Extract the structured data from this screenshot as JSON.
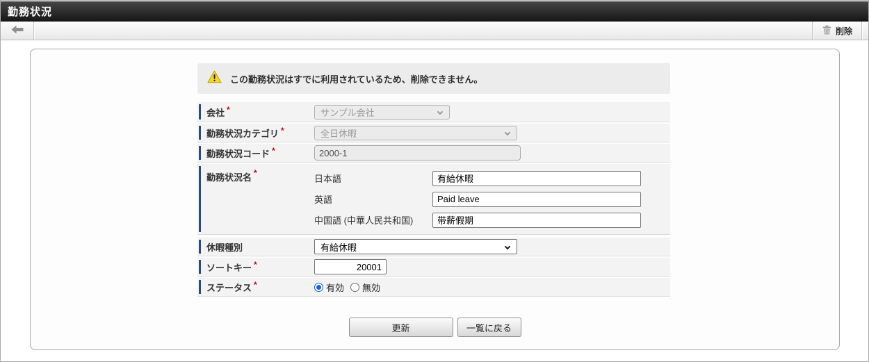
{
  "header": {
    "title": "勤務状況"
  },
  "toolbar": {
    "delete_label": "削除"
  },
  "warning": {
    "message": "この勤務状況はすでに利用されているため、削除できません。"
  },
  "marks": {
    "required": "*"
  },
  "fields": {
    "company": {
      "label": "会社",
      "value": "サンプル会社",
      "disabled": true
    },
    "category": {
      "label": "勤務状況カテゴリ",
      "value": "全日休暇",
      "disabled": true
    },
    "code": {
      "label": "勤務状況コード",
      "value": "2000-1",
      "readonly": true
    },
    "name": {
      "label": "勤務状況名",
      "entries": [
        {
          "lang": "日本語",
          "value": "有給休暇"
        },
        {
          "lang": "英語",
          "value": "Paid leave"
        },
        {
          "lang": "中国語 (中華人民共和国)",
          "value": "带薪假期"
        }
      ]
    },
    "leave_type": {
      "label": "休暇種別",
      "value": "有給休暇"
    },
    "sort_key": {
      "label": "ソートキー",
      "value": "20001"
    },
    "status": {
      "label": "ステータス",
      "options": [
        {
          "label": "有効",
          "selected": true
        },
        {
          "label": "無効",
          "selected": false
        }
      ]
    }
  },
  "buttons": {
    "update": "更新",
    "back_to_list": "一覧に戻る"
  },
  "colors": {
    "accent_bar": "#2b4a7b",
    "required_mark": "#cc0000",
    "warning_yellow": "#f8d71d",
    "selected_radio_blue": "#1565d8"
  }
}
